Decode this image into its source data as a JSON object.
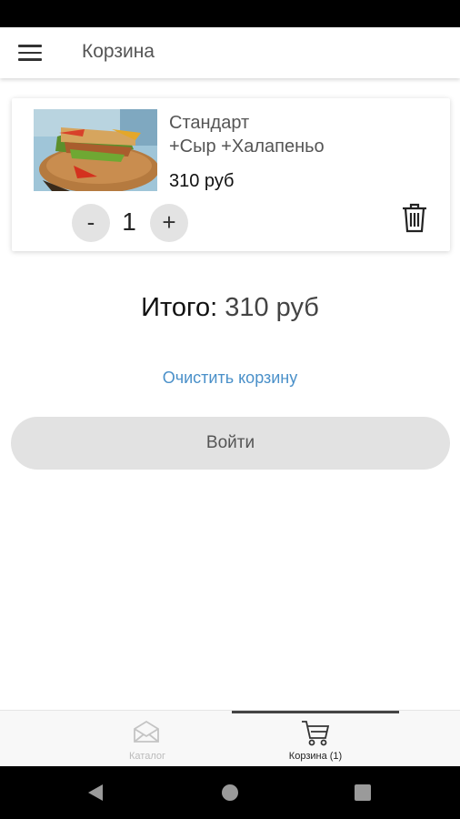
{
  "app_bar": {
    "title": "Корзина",
    "menu_icon": "hamburger-menu-icon"
  },
  "cart": {
    "items": [
      {
        "name": "Стандарт",
        "options": "+Сыр +Халапеньо",
        "price": "310 руб",
        "quantity": "1",
        "minus_label": "-",
        "plus_label": "+",
        "image": "sandwich-photo",
        "delete_icon": "trash-icon"
      }
    ]
  },
  "total": {
    "label": "Итого:",
    "value": "310 руб"
  },
  "actions": {
    "clear_label": "Очистить корзину",
    "login_label": "Войти"
  },
  "bottom_nav": {
    "tabs": [
      {
        "label": "Каталог",
        "icon": "envelope-icon",
        "active": false
      },
      {
        "label": "Корзина (1)",
        "icon": "cart-icon",
        "active": true
      }
    ]
  },
  "colors": {
    "link": "#4a90c9",
    "button_bg": "#e2e2e2",
    "status_bar": "#000000"
  }
}
